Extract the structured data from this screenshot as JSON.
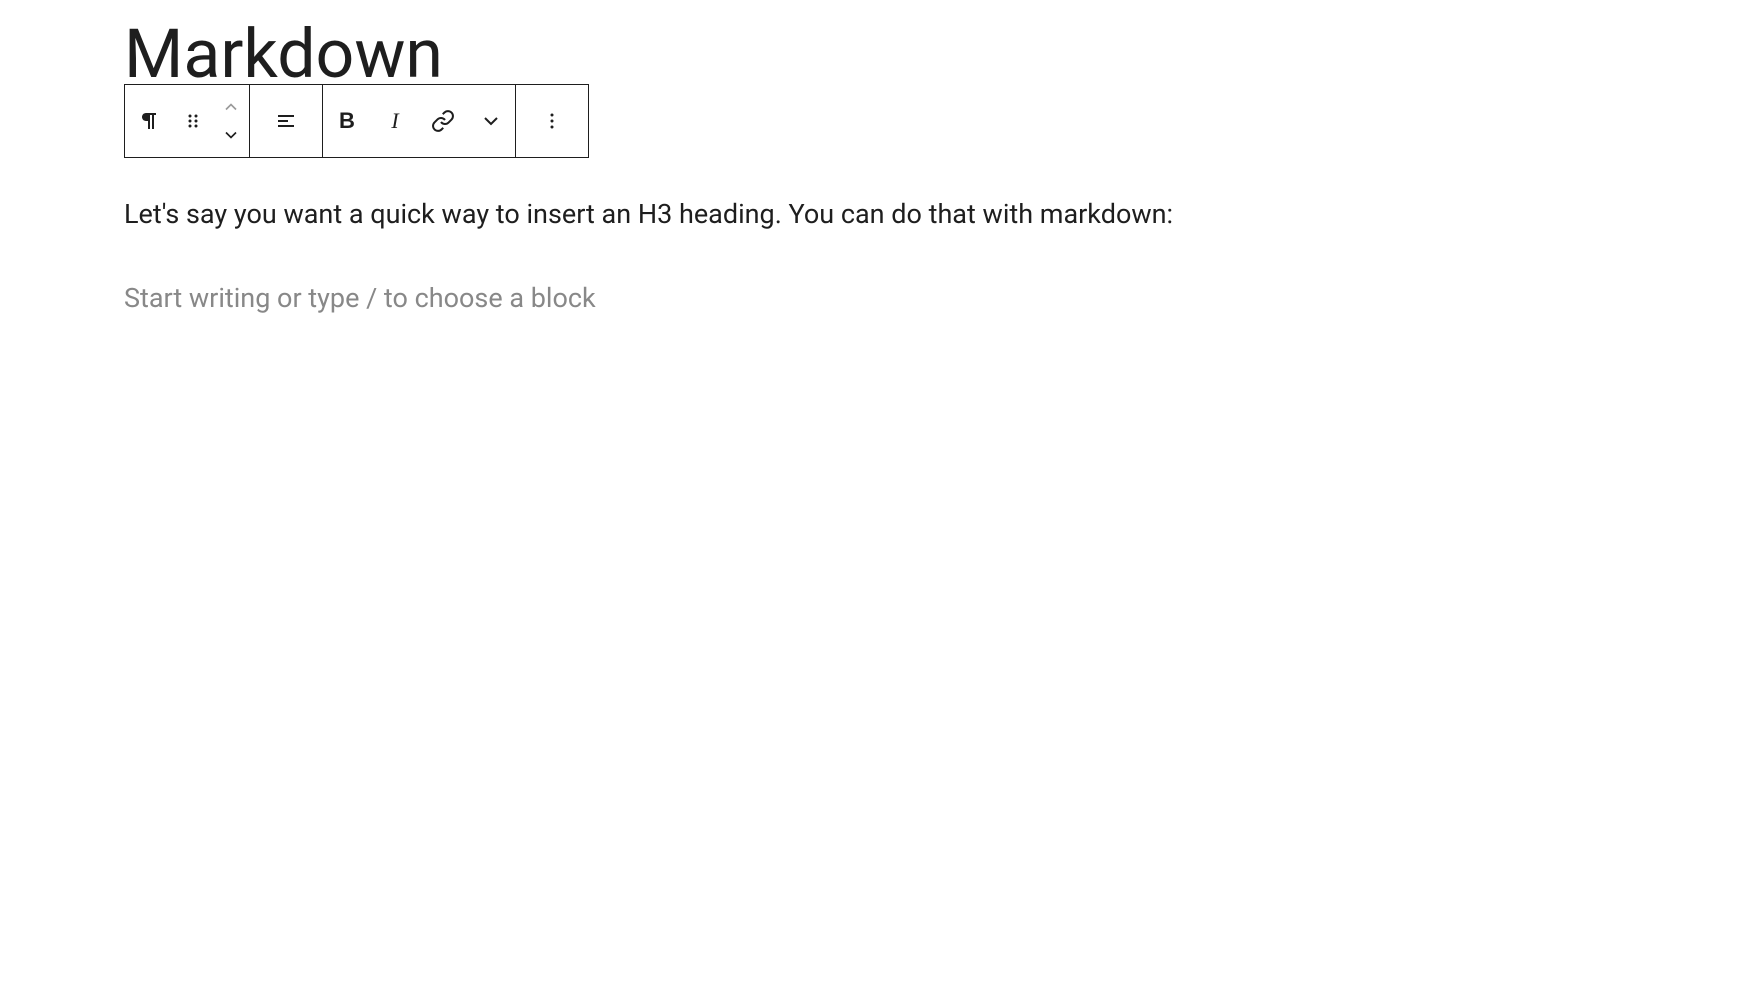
{
  "title": "Markdown",
  "paragraph": "Let's say you want a quick way to insert an H3 heading. You can do that with markdown:",
  "placeholder": "Start writing or type / to choose a block",
  "toolbar": {
    "bold_label": "B",
    "italic_label": "I"
  }
}
